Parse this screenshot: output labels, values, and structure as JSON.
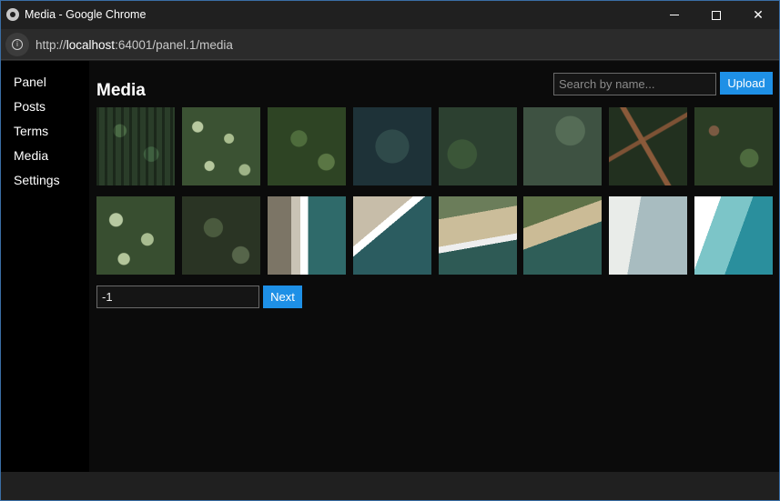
{
  "window": {
    "title": "Media - Google Chrome",
    "url_prefix": "http://",
    "url_host": "localhost",
    "url_rest": ":64001/panel.1/media"
  },
  "sidebar": {
    "items": [
      {
        "label": "Panel"
      },
      {
        "label": "Posts"
      },
      {
        "label": "Terms"
      },
      {
        "label": "Media"
      },
      {
        "label": "Settings"
      }
    ]
  },
  "main": {
    "title": "Media",
    "search": {
      "placeholder": "Search by name...",
      "value": ""
    },
    "upload_label": "Upload",
    "page_input_value": "-1",
    "next_label": "Next",
    "thumbnails": [
      {
        "texture": "forest"
      },
      {
        "texture": "forest-canopy-light"
      },
      {
        "texture": "forest"
      },
      {
        "texture": "forest-dark-blue"
      },
      {
        "texture": "forest"
      },
      {
        "texture": "forest-grey"
      },
      {
        "texture": "forest-trail"
      },
      {
        "texture": "forest-brown"
      },
      {
        "texture": "forest-canopy-light"
      },
      {
        "texture": "forest-dark"
      },
      {
        "texture": "beach-waves"
      },
      {
        "texture": "beach-coast"
      },
      {
        "texture": "beach-shore"
      },
      {
        "texture": "beach-cliff"
      },
      {
        "texture": "beach-sand-water"
      },
      {
        "texture": "beach-turquoise"
      }
    ]
  },
  "colors": {
    "accent": "#1e90e6",
    "content_bg": "#0b0b0b",
    "sidebar_bg": "#000000",
    "titlebar_bg": "#202020"
  }
}
